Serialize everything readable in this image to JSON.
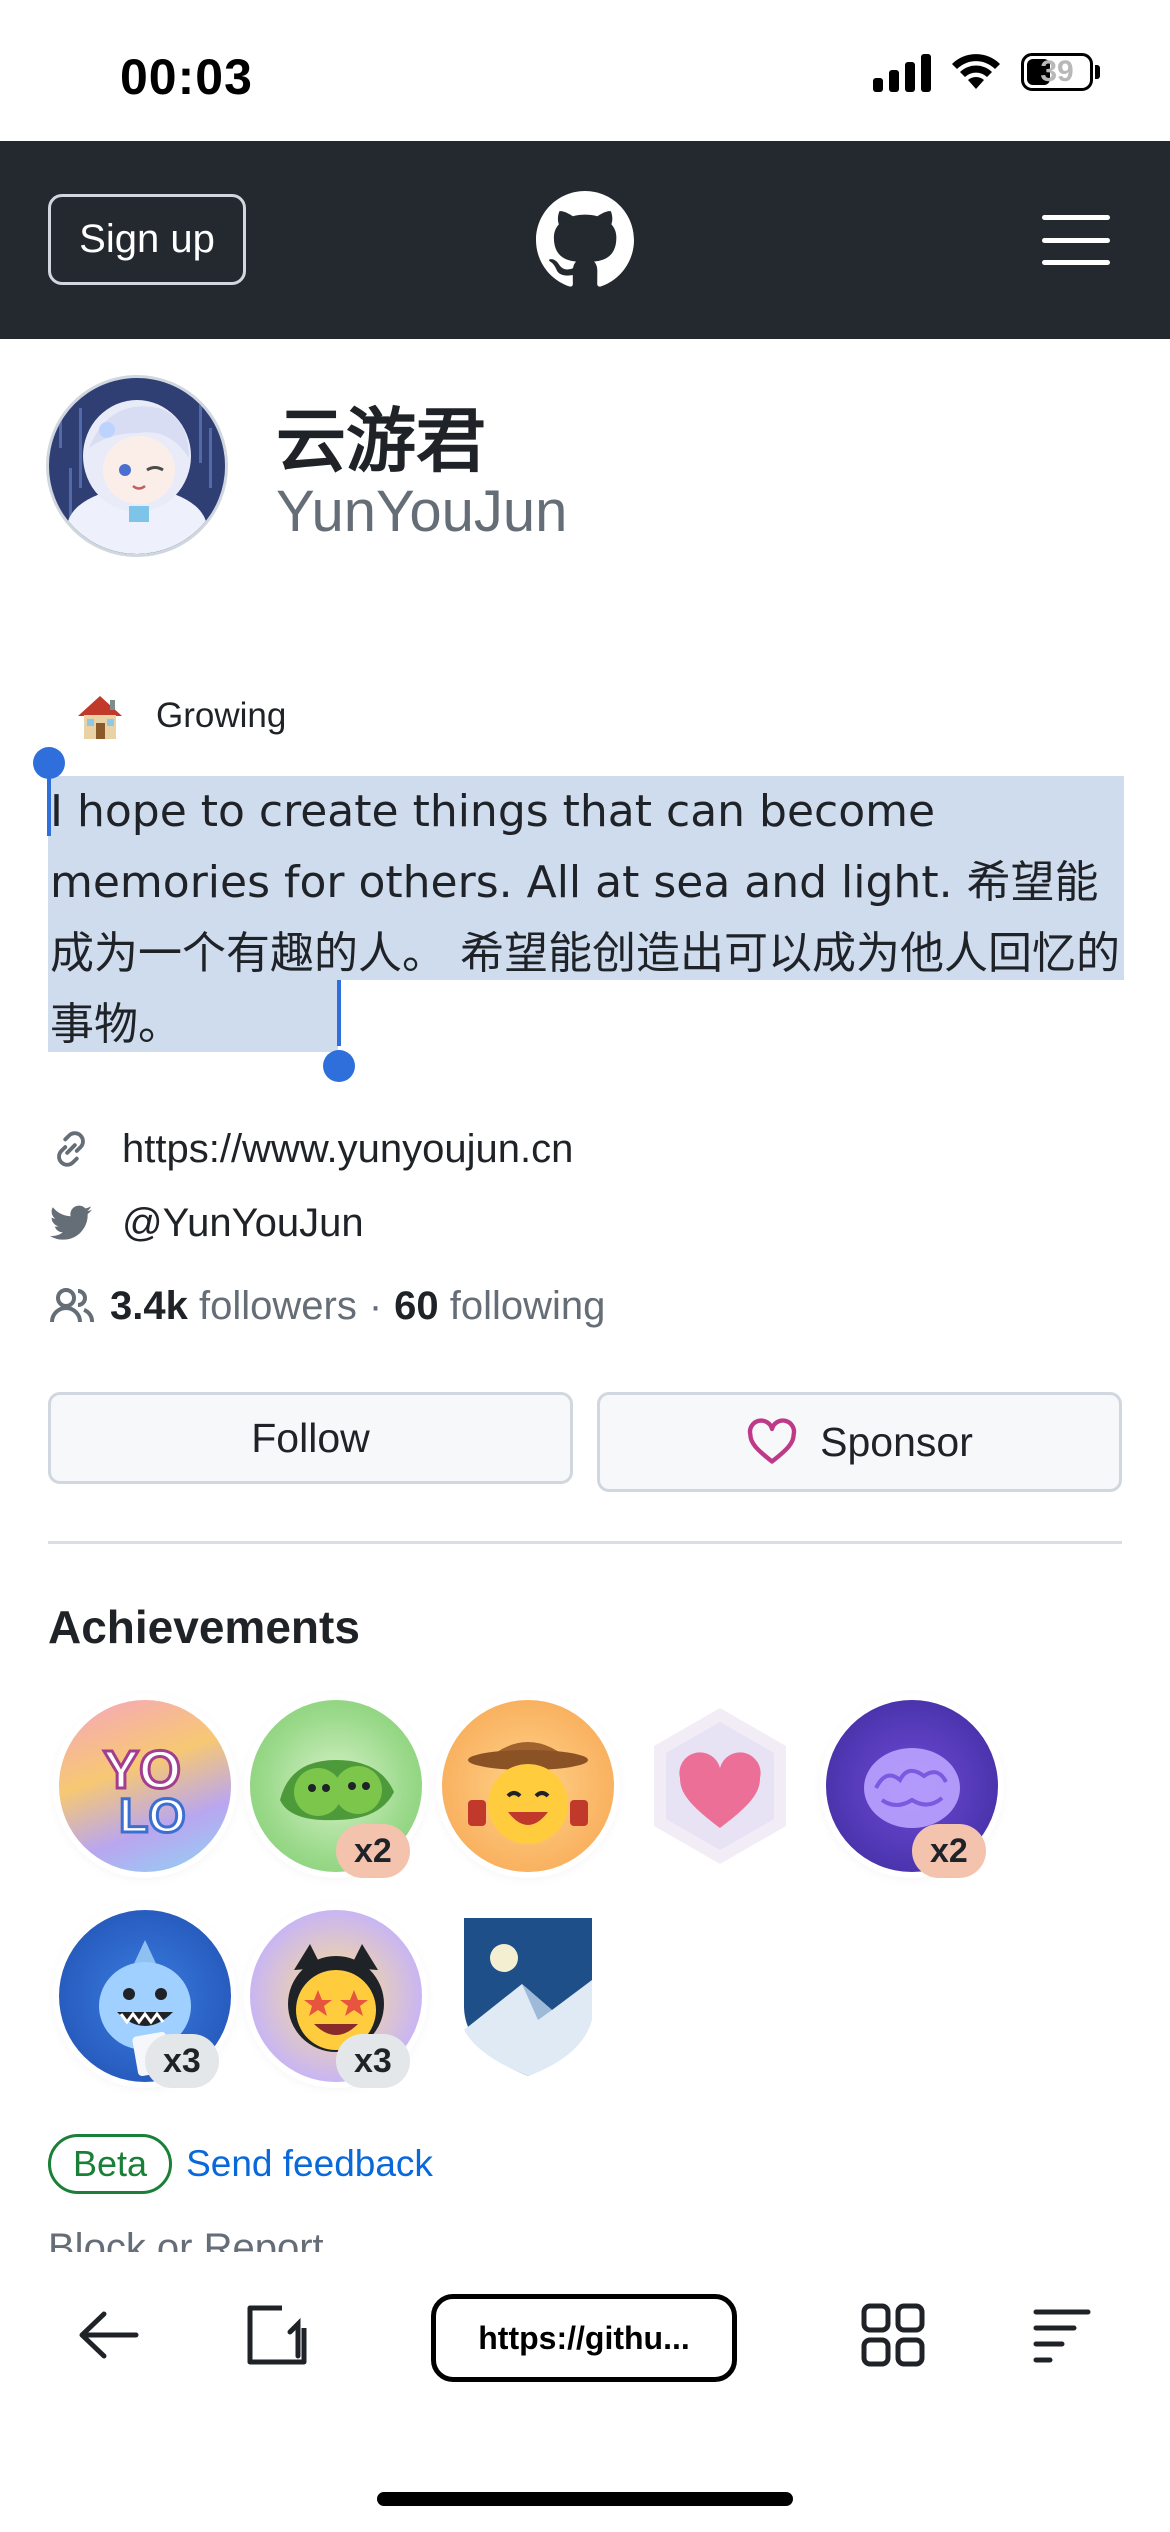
{
  "status_bar": {
    "time": "00:03",
    "battery": "39"
  },
  "header": {
    "signup_label": "Sign up"
  },
  "profile": {
    "display_name": "云游君",
    "username": "YunYouJun",
    "status_text": "Growing",
    "bio": "I hope to create things that can become memories for others. All at sea and light. 希望能成为一个有趣的人。 希望能创造出可以成为他人回忆的事物。",
    "website": "https://www.yunyoujun.cn",
    "twitter": "@YunYouJun",
    "followers_count": "3.4k",
    "followers_label": "followers",
    "separator": "·",
    "following_count": "60",
    "following_label": "following"
  },
  "actions": {
    "follow_label": "Follow",
    "sponsor_label": "Sponsor"
  },
  "achievements": {
    "title": "Achievements",
    "badges": [
      {
        "name": "yolo",
        "count": ""
      },
      {
        "name": "pair-extraordinaire",
        "count": "x2"
      },
      {
        "name": "quickdraw",
        "count": ""
      },
      {
        "name": "public-sponsor",
        "count": ""
      },
      {
        "name": "galaxy-brain",
        "count": "x2"
      },
      {
        "name": "pull-shark",
        "count": "x3"
      },
      {
        "name": "starstruck",
        "count": "x3"
      },
      {
        "name": "arctic-code-vault",
        "count": ""
      }
    ]
  },
  "beta": {
    "badge": "Beta",
    "feedback": "Send feedback"
  },
  "footer": {
    "block_report": "Block or Report"
  },
  "browser": {
    "url": "https://githu..."
  },
  "colors": {
    "header_bg": "#24292f",
    "link": "#0969da",
    "selection": "#cfdcee",
    "sponsor_heart": "#bf3989",
    "beta_green": "#1a7f37"
  }
}
